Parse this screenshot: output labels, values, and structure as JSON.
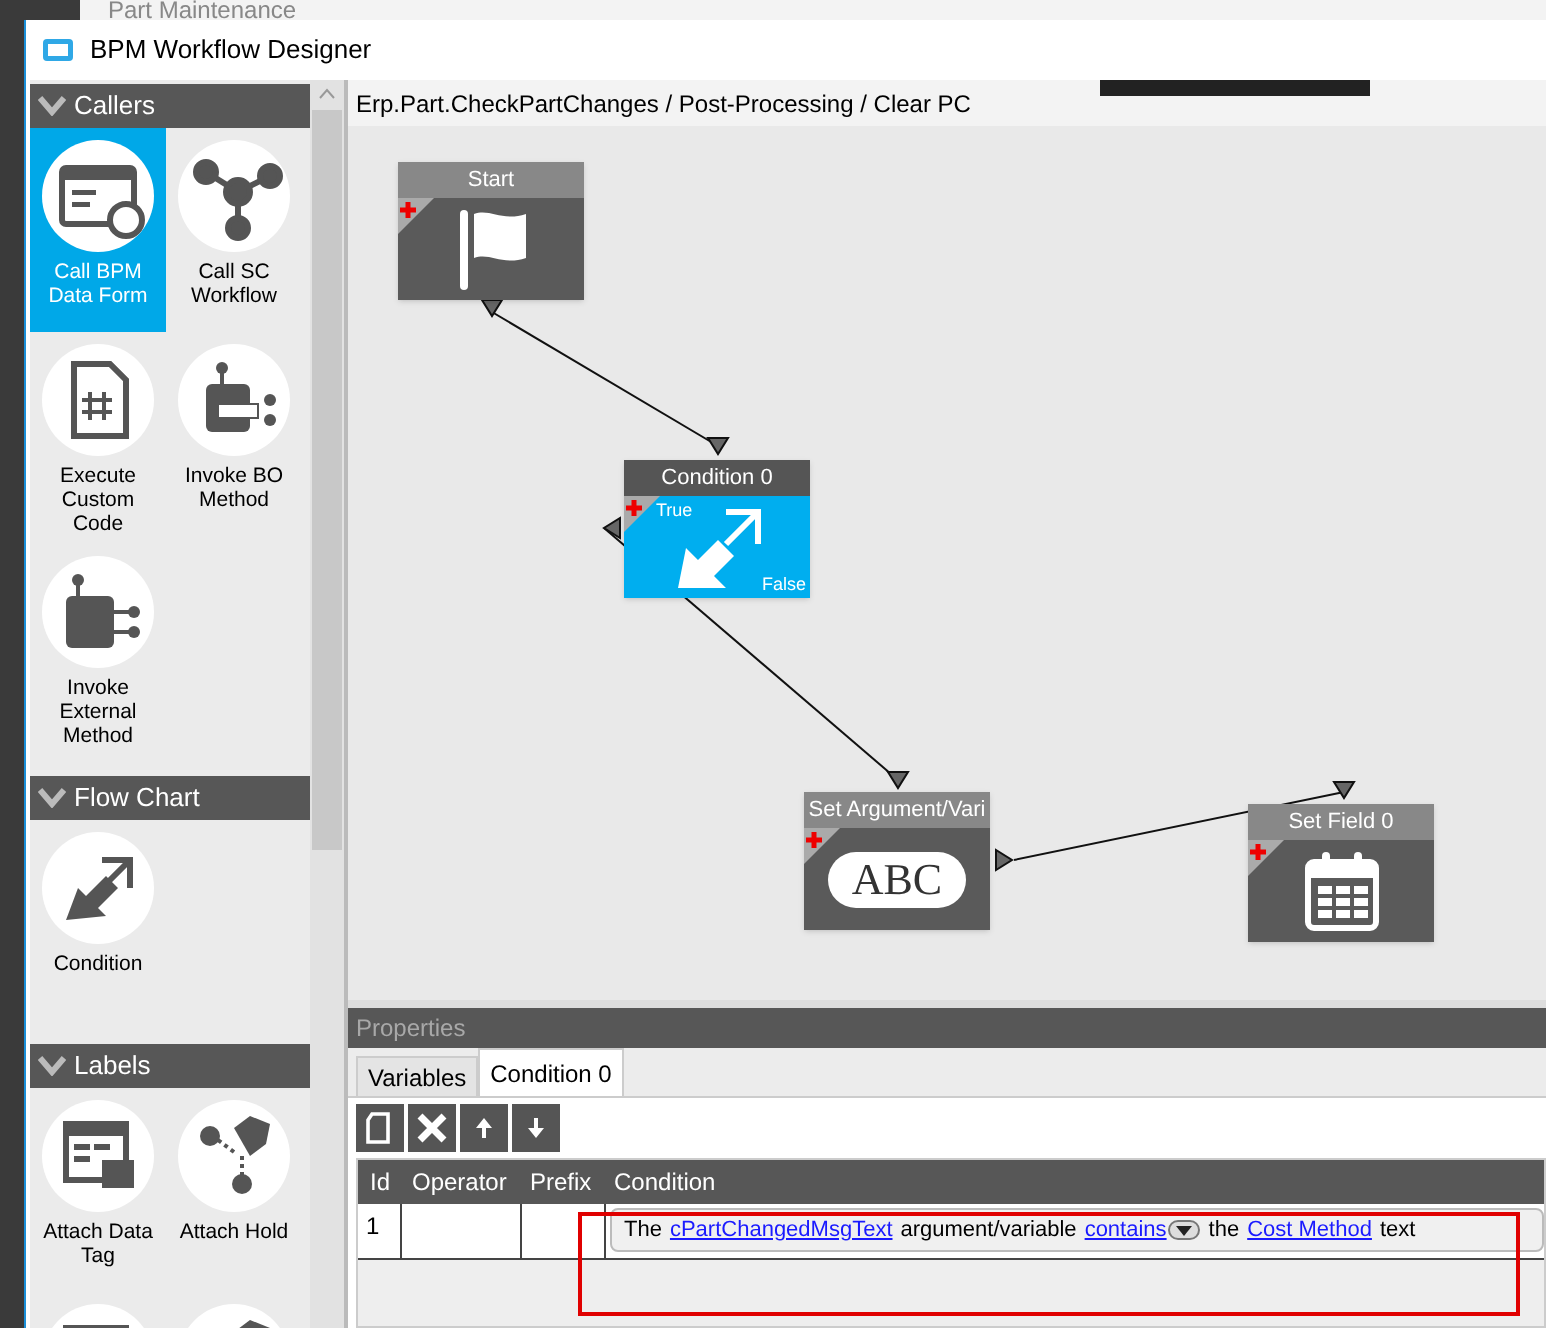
{
  "background_window": {
    "title": "Part Maintenance"
  },
  "window": {
    "title": "BPM Workflow Designer"
  },
  "palette": {
    "sections": [
      {
        "title": "Callers",
        "items": [
          {
            "label": "Call BPM Data Form",
            "kind": "data-form",
            "selected": true
          },
          {
            "label": "Call SC Workflow",
            "kind": "workflow",
            "selected": false
          },
          {
            "label": "Execute Custom Code",
            "kind": "code",
            "selected": false
          },
          {
            "label": "Invoke BO Method",
            "kind": "bo-method",
            "selected": false
          },
          {
            "label": "Invoke External Method",
            "kind": "external",
            "selected": false
          }
        ]
      },
      {
        "title": "Flow Chart",
        "items": [
          {
            "label": "Condition",
            "kind": "condition",
            "selected": false
          }
        ]
      },
      {
        "title": "Labels",
        "items": [
          {
            "label": "Attach Data Tag",
            "kind": "data-tag",
            "selected": false
          },
          {
            "label": "Attach Hold",
            "kind": "hold",
            "selected": false
          },
          {
            "kind": "data-tag",
            "selected": false
          },
          {
            "kind": "hold",
            "selected": false
          }
        ]
      }
    ]
  },
  "breadcrumb": "Erp.Part.CheckPartChanges / Post-Processing / Clear PC",
  "nodes": [
    {
      "title": "Start",
      "kind": "start",
      "selected": false
    },
    {
      "title": "Condition 0",
      "kind": "condition",
      "selected": true,
      "true_label": "True",
      "false_label": "False"
    },
    {
      "title": "Set Argument/Vari",
      "kind": "set-argument",
      "selected": false,
      "icon_text": "ABC"
    },
    {
      "title": "Set Field 0",
      "kind": "set-field",
      "selected": false
    }
  ],
  "properties": {
    "title": "Properties",
    "tabs": [
      {
        "label": "Variables",
        "selected": false
      },
      {
        "label": "Condition 0",
        "selected": true
      }
    ],
    "toolbar": [
      {
        "kind": "new"
      },
      {
        "kind": "delete"
      },
      {
        "kind": "up"
      },
      {
        "kind": "down"
      }
    ],
    "table": {
      "columns": [
        "Id",
        "Operator",
        "Prefix",
        "Condition"
      ],
      "rows": [
        {
          "id": "1",
          "operator": "",
          "prefix": "",
          "condition": [
            {
              "kind": "text",
              "text": "The"
            },
            {
              "kind": "link",
              "text": "cPartChangedMsgText"
            },
            {
              "kind": "text",
              "text": "argument/variable"
            },
            {
              "kind": "dropdown-link",
              "text": "contains"
            },
            {
              "kind": "text",
              "text": "the"
            },
            {
              "kind": "link",
              "text": "Cost Method"
            },
            {
              "kind": "text",
              "text": "text"
            }
          ]
        }
      ]
    }
  }
}
